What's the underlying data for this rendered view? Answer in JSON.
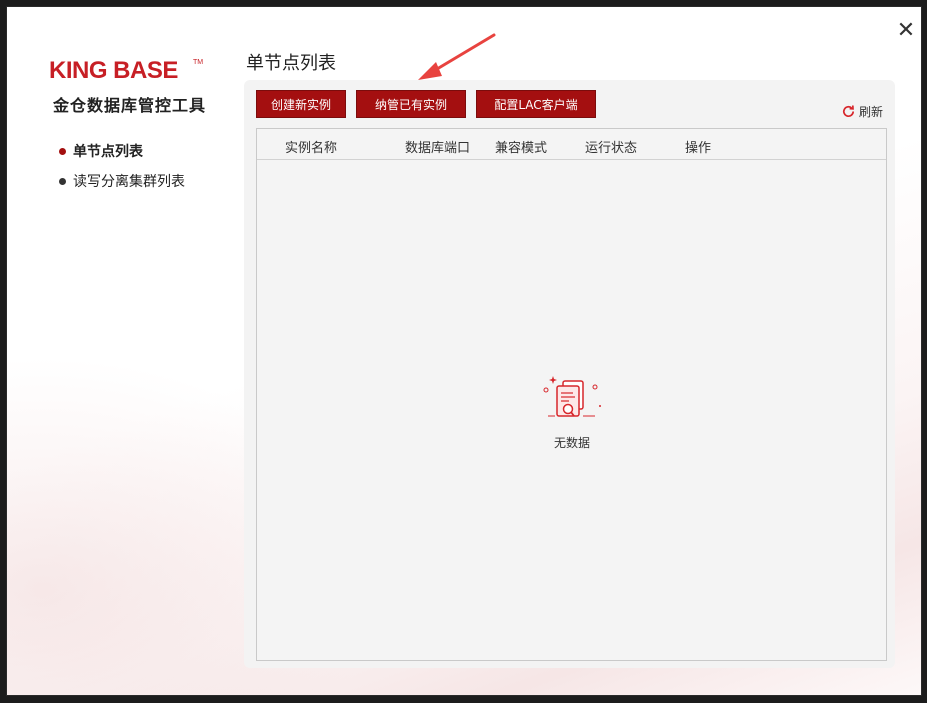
{
  "window": {
    "close_icon": "close-icon",
    "close_glyph": "✕"
  },
  "sidebar": {
    "logo_text": "KING BASE",
    "logo_tm": "TM",
    "app_title": "金仓数据库管控工具",
    "items": [
      {
        "label": "单节点列表",
        "active": true
      },
      {
        "label": "读写分离集群列表",
        "active": false
      }
    ]
  },
  "main": {
    "page_title": "单节点列表",
    "buttons": {
      "create": "创建新实例",
      "manage": "纳管已有实例",
      "lac": "配置LAC客户端"
    },
    "refresh_label": "刷新",
    "table": {
      "columns": [
        "实例名称",
        "数据库端口",
        "兼容模式",
        "运行状态",
        "操作"
      ],
      "rows": [],
      "empty_text": "无数据"
    }
  },
  "colors": {
    "brand": "#a40f10",
    "accent_red": "#d7262b"
  }
}
